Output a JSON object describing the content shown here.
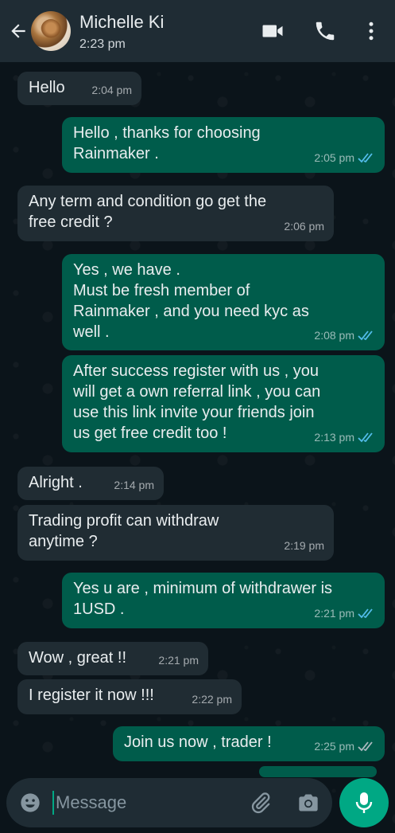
{
  "header": {
    "contact_name": "Michelle Ki",
    "status": "2:23 pm",
    "icons": [
      "back-arrow-icon",
      "video-call-icon",
      "phone-call-icon",
      "more-options-icon"
    ]
  },
  "messages": [
    {
      "dir": "in",
      "text": "Hello",
      "time": "2:04 pm"
    },
    {
      "dir": "out",
      "text": "Hello , thanks for choosing\nRainmaker .",
      "time": "2:05 pm",
      "read": true
    },
    {
      "dir": "in",
      "text": "Any term and condition go get the\nfree credit ?",
      "time": "2:06 pm"
    },
    {
      "dir": "out",
      "text": "Yes , we have .\nMust be fresh member of\nRainmaker , and you need kyc as\nwell .",
      "time": "2:08 pm",
      "read": true
    },
    {
      "dir": "out",
      "text": "After success register with us , you\nwill get a own referral link , you can\nuse this link invite your friends join\nus get free credit too !",
      "time": "2:13 pm",
      "read": true
    },
    {
      "dir": "in",
      "text": "Alright .",
      "time": "2:14 pm"
    },
    {
      "dir": "in",
      "text": "Trading profit can withdraw\nanytime ?",
      "time": "2:19 pm"
    },
    {
      "dir": "out",
      "text": "Yes u are , minimum of withdrawer is\n1USD .",
      "time": "2:21 pm",
      "read": true
    },
    {
      "dir": "in",
      "text": "Wow , great !!",
      "time": "2:21 pm"
    },
    {
      "dir": "in",
      "text": "I register it now !!!",
      "time": "2:22 pm"
    },
    {
      "dir": "out",
      "text": "Join us now , trader !",
      "time": "2:25 pm",
      "read": false
    }
  ],
  "composer": {
    "placeholder": "Message",
    "icons": [
      "emoji-icon",
      "attach-icon",
      "camera-icon",
      "mic-icon"
    ]
  },
  "colors": {
    "background": "#0b141a",
    "header": "#1f2c34",
    "incoming": "#202c33",
    "outgoing": "#005c4b",
    "accent": "#00a884",
    "read_tick": "#53bdeb"
  }
}
